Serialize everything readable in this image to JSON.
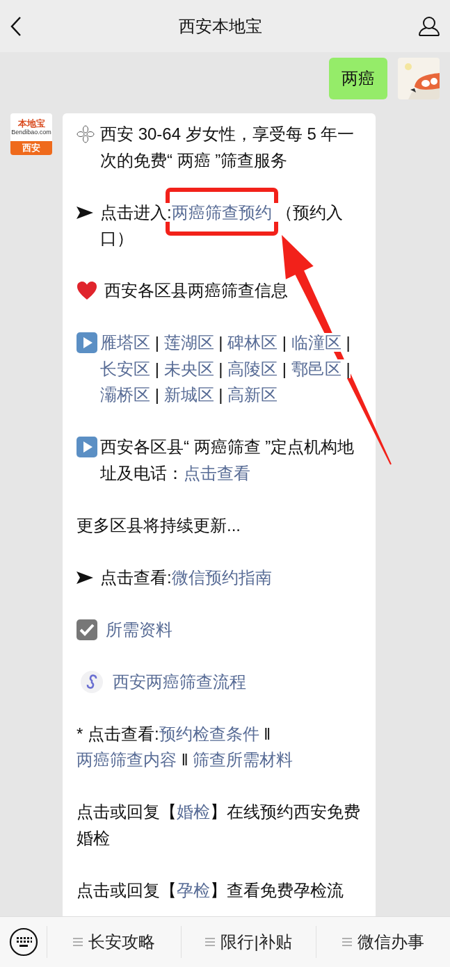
{
  "header": {
    "title": "西安本地宝"
  },
  "outgoing": {
    "text": "两癌"
  },
  "incoming": {
    "avatar": {
      "brand": "本地宝",
      "domain": "Bendibao.com",
      "city": "西安"
    },
    "paragraphs": [
      {
        "kind": "sparkle",
        "segments": [
          {
            "kind": "text",
            "text": "西安 30-64 岁女性，享受每 5 年一次的免费“ 两癌 ”筛查服务"
          }
        ]
      },
      {
        "kind": "arrow",
        "segments": [
          {
            "kind": "text",
            "text": "点击进入:"
          },
          {
            "kind": "highlighted_link",
            "text": "两癌筛查预约"
          },
          {
            "kind": "text",
            "text": " （预约入口）"
          }
        ]
      },
      {
        "kind": "heart",
        "segments": [
          {
            "kind": "text",
            "text": "西安各区县两癌筛查信息"
          }
        ]
      },
      {
        "kind": "play",
        "segments": [
          {
            "kind": "link",
            "text": "雁塔区"
          },
          {
            "kind": "text",
            "text": " | "
          },
          {
            "kind": "link",
            "text": "莲湖区"
          },
          {
            "kind": "text",
            "text": " | "
          },
          {
            "kind": "link",
            "text": "碑林区"
          },
          {
            "kind": "text",
            "text": " | "
          },
          {
            "kind": "link",
            "text": "临潼区"
          },
          {
            "kind": "text",
            "text": " | "
          },
          {
            "kind": "link",
            "text": "长安区"
          },
          {
            "kind": "text",
            "text": " | "
          },
          {
            "kind": "link",
            "text": "未央区"
          },
          {
            "kind": "text",
            "text": " | "
          },
          {
            "kind": "link",
            "text": "高陵区"
          },
          {
            "kind": "text",
            "text": " | "
          },
          {
            "kind": "link",
            "text": "鄠邑区"
          },
          {
            "kind": "text",
            "text": " | "
          },
          {
            "kind": "link",
            "text": "灞桥区"
          },
          {
            "kind": "text",
            "text": " | "
          },
          {
            "kind": "link",
            "text": "新城区"
          },
          {
            "kind": "text",
            "text": " | "
          },
          {
            "kind": "link",
            "text": "高新区"
          }
        ]
      },
      {
        "kind": "play",
        "segments": [
          {
            "kind": "text",
            "text": "西安各区县“ 两癌筛查 ”定点机构地址及电话："
          },
          {
            "kind": "link",
            "text": "点击查看"
          }
        ]
      },
      {
        "kind": "plain",
        "segments": [
          {
            "kind": "text",
            "text": "更多区县将持续更新..."
          }
        ]
      },
      {
        "kind": "arrow",
        "segments": [
          {
            "kind": "text",
            "text": "点击查看:"
          },
          {
            "kind": "link",
            "text": "微信预约指南"
          }
        ]
      },
      {
        "kind": "check",
        "segments": [
          {
            "kind": "link",
            "text": "所需资料"
          }
        ]
      },
      {
        "kind": "miniprogram",
        "segments": [
          {
            "kind": "link",
            "text": "西安两癌筛查流程"
          }
        ]
      },
      {
        "kind": "plain",
        "segments": [
          {
            "kind": "text",
            "text": "* 点击查看:"
          },
          {
            "kind": "link",
            "text": "预约检查条件"
          },
          {
            "kind": "text",
            "text": " ‖ "
          },
          {
            "kind": "link",
            "text": "两癌筛查内容"
          },
          {
            "kind": "text",
            "text": " ‖ "
          },
          {
            "kind": "link",
            "text": "筛查所需材料"
          }
        ]
      },
      {
        "kind": "plain",
        "segments": [
          {
            "kind": "text",
            "text": "点击或回复【"
          },
          {
            "kind": "link",
            "text": "婚检"
          },
          {
            "kind": "text",
            "text": "】在线预约西安免费婚检"
          }
        ]
      },
      {
        "kind": "plain",
        "segments": [
          {
            "kind": "text",
            "text": "点击或回复【"
          },
          {
            "kind": "link",
            "text": "孕检"
          },
          {
            "kind": "text",
            "text": "】查看免费孕检流"
          }
        ]
      }
    ]
  },
  "menu": [
    {
      "label": "长安攻略"
    },
    {
      "label": "限行|补贴"
    },
    {
      "label": "微信办事"
    }
  ]
}
